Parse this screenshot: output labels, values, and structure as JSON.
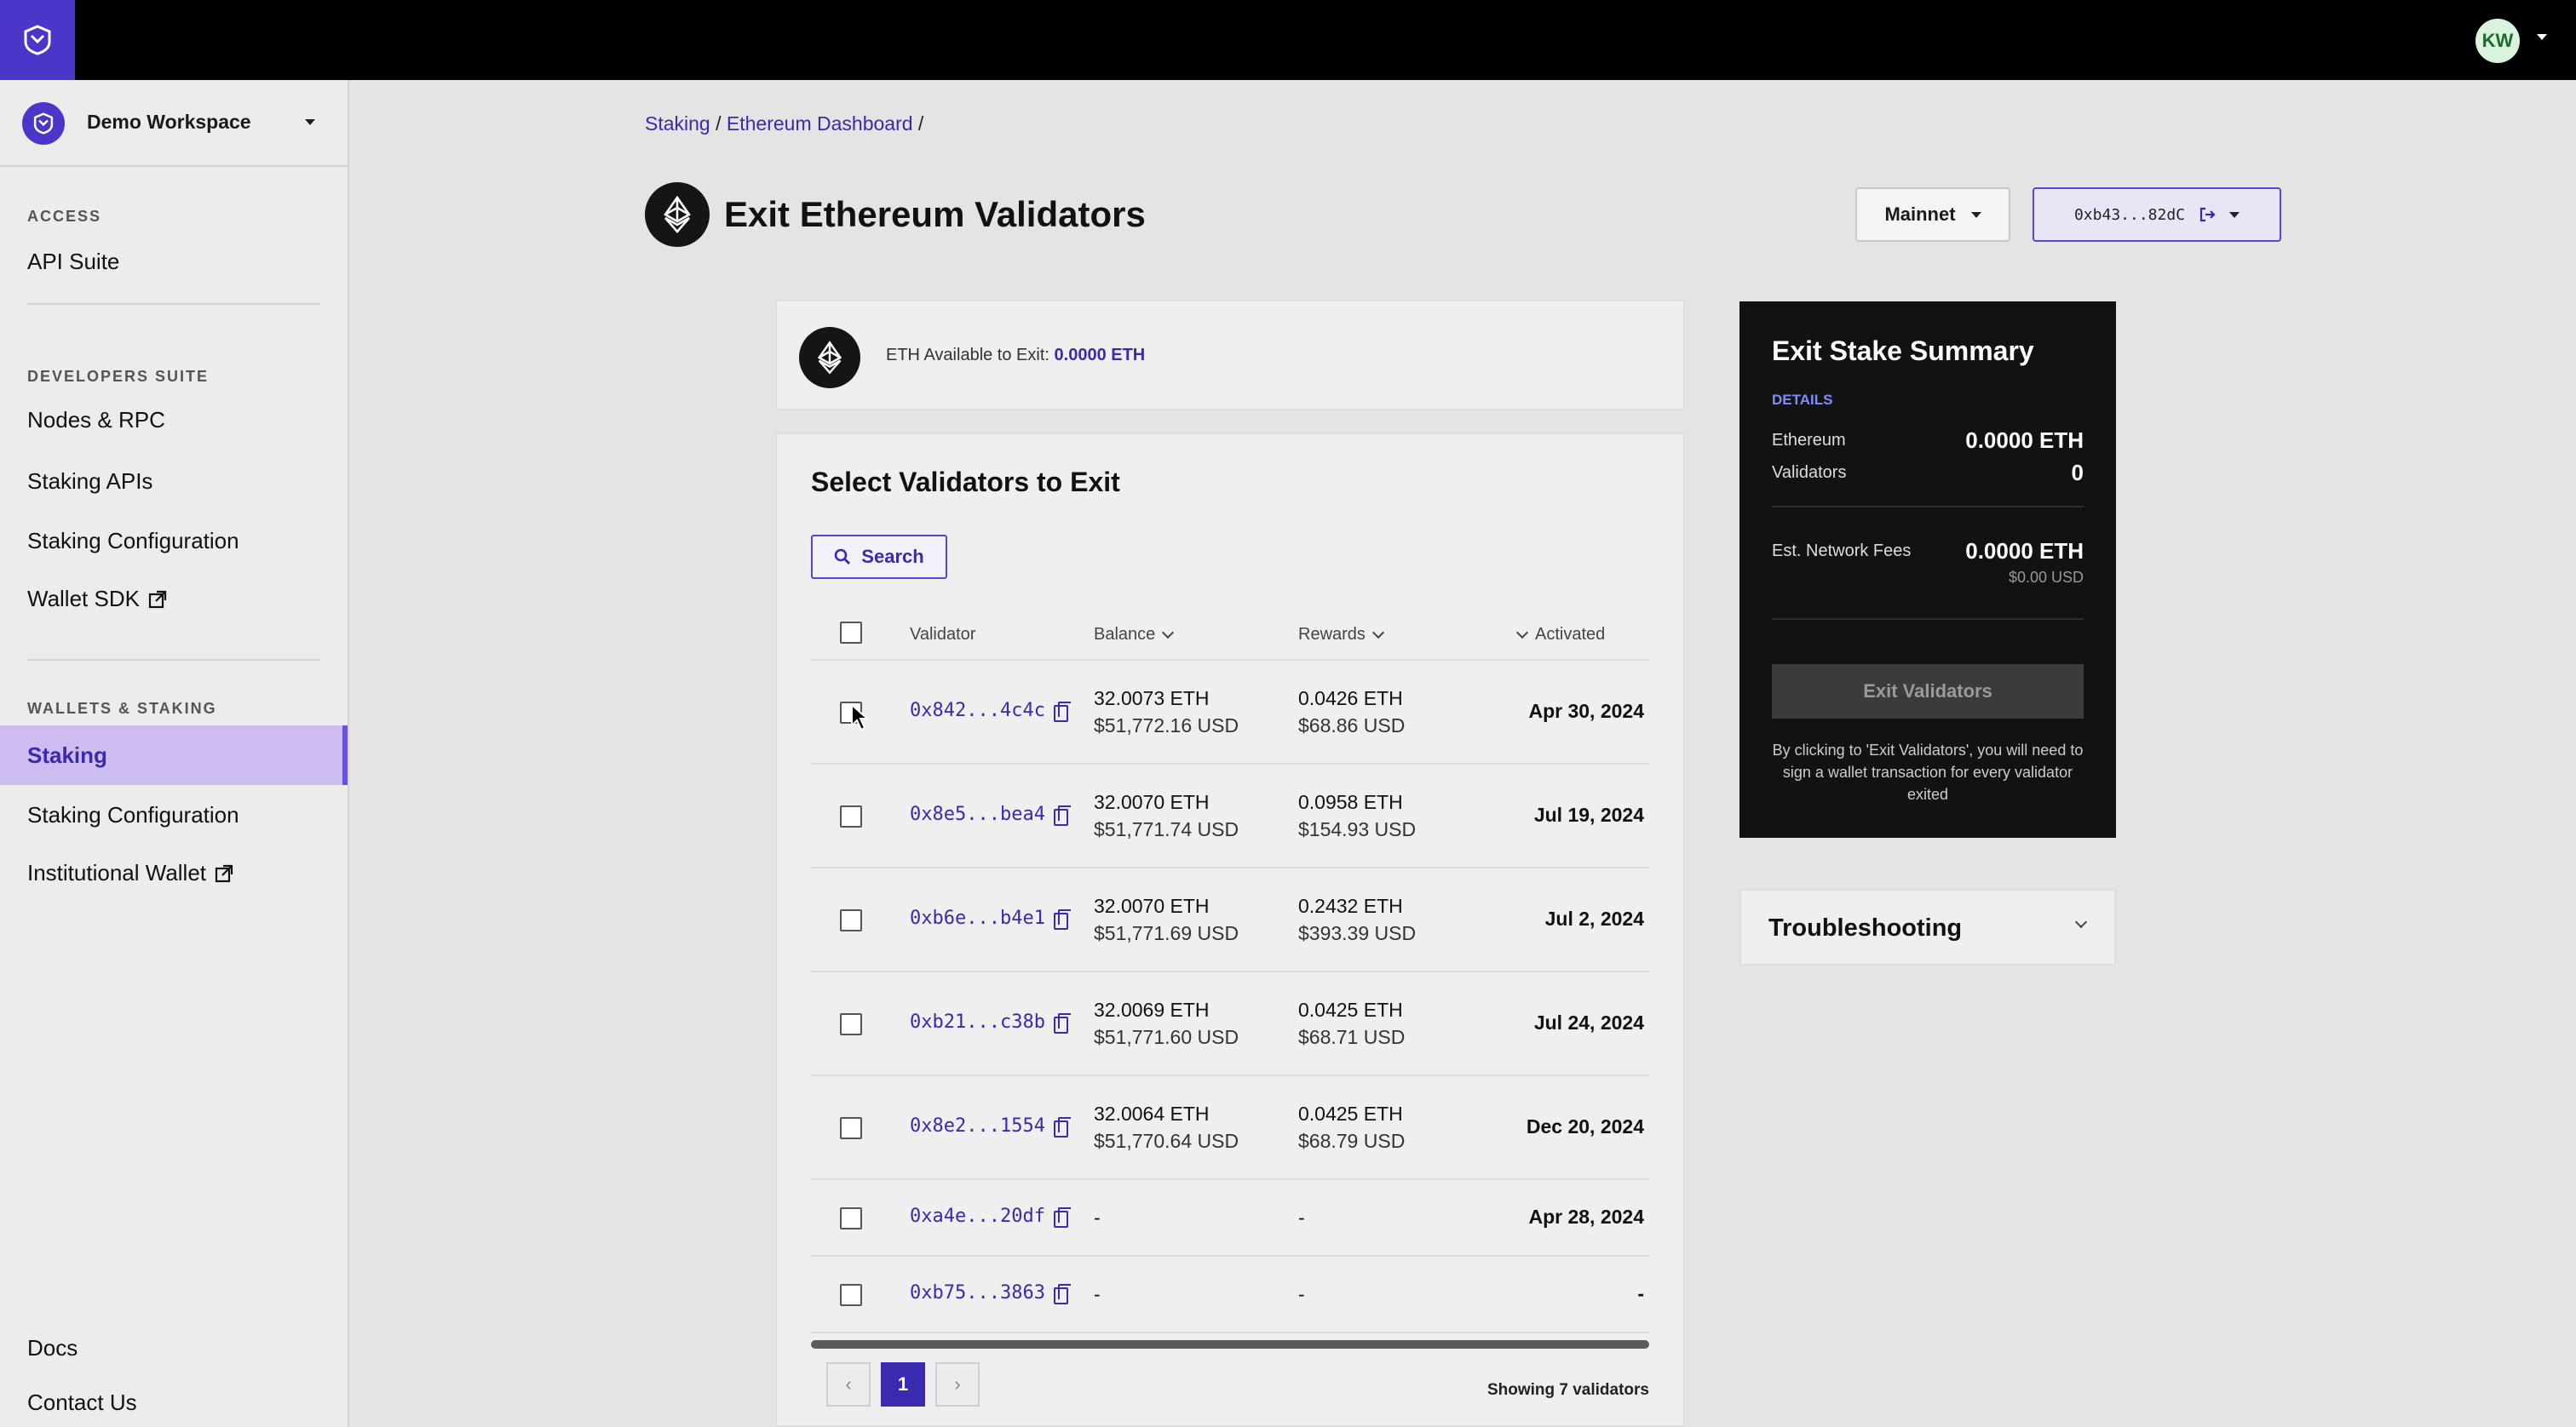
{
  "topbar": {
    "avatar_initials": "KW"
  },
  "sidebar": {
    "workspace": "Demo Workspace",
    "sections": [
      {
        "heading": "ACCESS",
        "items": [
          "API Suite"
        ]
      },
      {
        "heading": "DEVELOPERS SUITE",
        "items": [
          "Nodes & RPC",
          "Staking APIs",
          "Staking Configuration",
          "Wallet SDK"
        ]
      },
      {
        "heading": "WALLETS & STAKING",
        "items": [
          "Staking",
          "Staking Configuration",
          "Institutional Wallet"
        ]
      }
    ],
    "footer": [
      "Docs",
      "Contact Us"
    ],
    "active_item": "Staking"
  },
  "breadcrumb": {
    "items": [
      "Staking",
      "Ethereum Dashboard"
    ],
    "separator": "/"
  },
  "page": {
    "title": "Exit Ethereum Validators",
    "network": "Mainnet",
    "wallet_address": "0xb43...82dC"
  },
  "available": {
    "label": "ETH Available to Exit:",
    "value": "0.0000 ETH"
  },
  "validators": {
    "title": "Select Validators to Exit",
    "search_label": "Search",
    "columns": [
      "Validator",
      "Balance",
      "Rewards",
      "Activated"
    ],
    "rows": [
      {
        "address": "0x842...4c4c",
        "balance_eth": "32.0073 ETH",
        "balance_usd": "$51,772.16 USD",
        "rewards_eth": "0.0426 ETH",
        "rewards_usd": "$68.86 USD",
        "activated": "Apr 30, 2024"
      },
      {
        "address": "0x8e5...bea4",
        "balance_eth": "32.0070 ETH",
        "balance_usd": "$51,771.74 USD",
        "rewards_eth": "0.0958 ETH",
        "rewards_usd": "$154.93 USD",
        "activated": "Jul 19, 2024"
      },
      {
        "address": "0xb6e...b4e1",
        "balance_eth": "32.0070 ETH",
        "balance_usd": "$51,771.69 USD",
        "rewards_eth": "0.2432 ETH",
        "rewards_usd": "$393.39 USD",
        "activated": "Jul 2, 2024"
      },
      {
        "address": "0xb21...c38b",
        "balance_eth": "32.0069 ETH",
        "balance_usd": "$51,771.60 USD",
        "rewards_eth": "0.0425 ETH",
        "rewards_usd": "$68.71 USD",
        "activated": "Jul 24, 2024"
      },
      {
        "address": "0x8e2...1554",
        "balance_eth": "32.0064 ETH",
        "balance_usd": "$51,770.64 USD",
        "rewards_eth": "0.0425 ETH",
        "rewards_usd": "$68.79 USD",
        "activated": "Dec 20, 2024"
      },
      {
        "address": "0xa4e...20df",
        "balance_eth": "-",
        "balance_usd": "",
        "rewards_eth": "-",
        "rewards_usd": "",
        "activated": "Apr 28, 2024"
      },
      {
        "address": "0xb75...3863",
        "balance_eth": "-",
        "balance_usd": "",
        "rewards_eth": "-",
        "rewards_usd": "",
        "activated": "-"
      }
    ],
    "pagination": {
      "prev": "‹",
      "current": "1",
      "next": "›"
    },
    "showing": "Showing 7 validators"
  },
  "summary": {
    "title": "Exit Stake Summary",
    "details_label": "DETAILS",
    "ethereum_label": "Ethereum",
    "ethereum_value": "0.0000 ETH",
    "validators_label": "Validators",
    "validators_value": "0",
    "fees_label": "Est. Network Fees",
    "fees_value": "0.0000 ETH",
    "fees_usd": "$0.00 USD",
    "exit_button": "Exit Validators",
    "note": "By clicking to 'Exit Validators', you will need to sign a wallet transaction for every validator exited"
  },
  "troubleshooting": {
    "label": "Troubleshooting"
  },
  "colors": {
    "brand": "#4a36c9",
    "link": "#3a2ab0",
    "active_bg": "#cdbcf0"
  }
}
